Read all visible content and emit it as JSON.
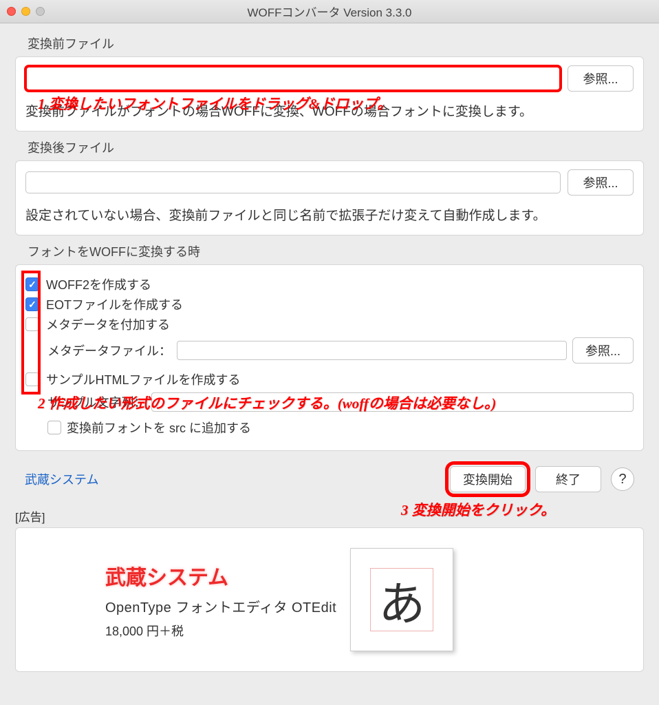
{
  "window": {
    "title": "WOFFコンバータ Version 3.3.0"
  },
  "source": {
    "label": "変換前ファイル",
    "value": "",
    "browse": "参照...",
    "hint": "変換前ファイルがフォントの場合WOFFに変換、WOFFの場合フォントに変換します。"
  },
  "dest": {
    "label": "変換後ファイル",
    "value": "",
    "browse": "参照...",
    "hint": "設定されていない場合、変換前ファイルと同じ名前で拡張子だけ変えて自動作成します。"
  },
  "options": {
    "label": "フォントをWOFFに変換する時",
    "woff2": "WOFF2を作成する",
    "eot": "EOTファイルを作成する",
    "meta": "メタデータを付加する",
    "metafile_label": "メタデータファイル：",
    "metafile_value": "",
    "metafile_browse": "参照...",
    "sample_html": "サンプルHTMLファイルを作成する",
    "sample_text_label": "サンプル文字列：",
    "sample_text_value": "",
    "add_src": "変換前フォントを src に追加する"
  },
  "footer": {
    "link": "武蔵システム",
    "convert": "変換開始",
    "quit": "終了",
    "help": "?"
  },
  "ad": {
    "label": "[広告]",
    "title": "武蔵システム",
    "subtitle": "OpenType フォントエディタ OTEdit",
    "price": "18,000 円＋税",
    "glyph": "あ"
  },
  "annotations": {
    "a1": "1 変換したいフォントファイルをドラッグ&ドロップ。",
    "a2": "2 作成したい形式のファイルにチェックする。(woffの場合は必要なし。)",
    "a3": "3 変換開始をクリック。"
  }
}
